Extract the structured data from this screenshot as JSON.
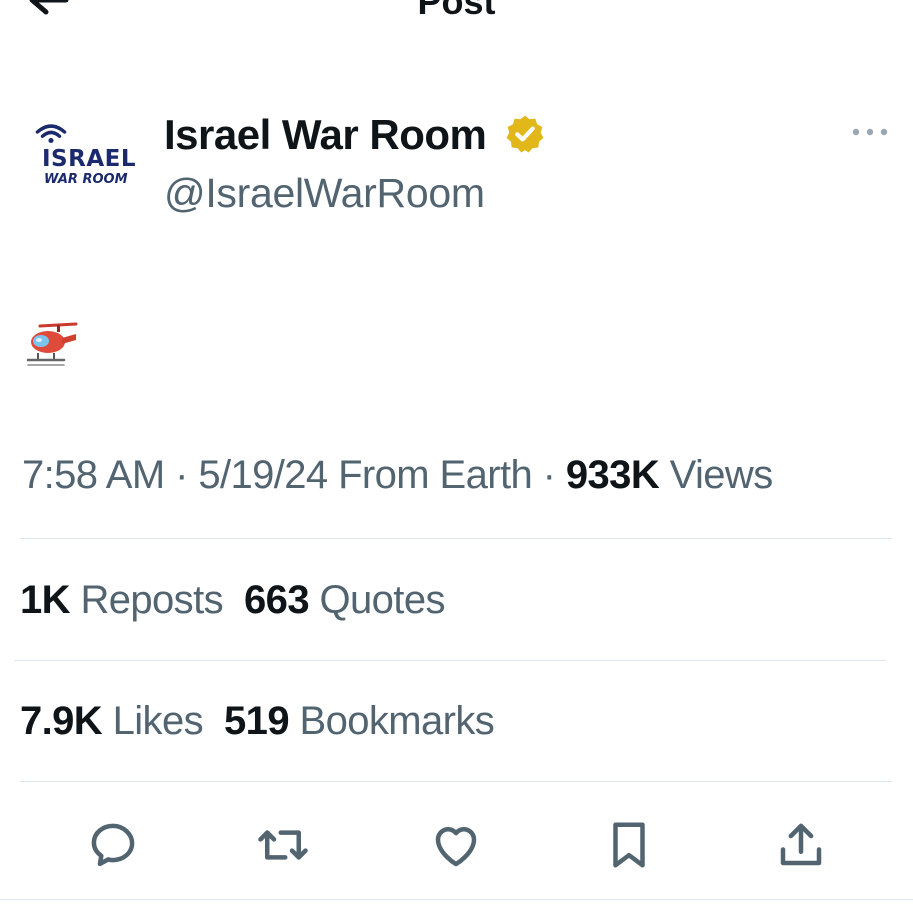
{
  "header": {
    "title": "Post",
    "back_icon": "arrow-left-icon"
  },
  "author": {
    "avatar_logo_line1": "ISRAEL",
    "avatar_logo_line2": "WAR ROOM",
    "display_name": "Israel War Room",
    "handle": "@IsraelWarRoom",
    "verified_icon": "verified-gold-badge-icon",
    "more_icon": "more-horizontal-icon"
  },
  "post": {
    "body_emoji": "helicopter-emoji",
    "time": "7:58 AM",
    "date": "5/19/24",
    "location": "From Earth",
    "views_count": "933K",
    "views_label": "Views"
  },
  "stats": {
    "reposts_count": "1K",
    "reposts_label": "Reposts",
    "quotes_count": "663",
    "quotes_label": "Quotes",
    "likes_count": "7.9K",
    "likes_label": "Likes",
    "bookmarks_count": "519",
    "bookmarks_label": "Bookmarks"
  },
  "actions": [
    "reply-icon",
    "repost-icon",
    "like-icon",
    "bookmark-icon",
    "share-icon"
  ],
  "colors": {
    "text": "#0f1419",
    "secondary": "#536471",
    "divider": "#e1e6ea",
    "verified_gold": "#e2b719",
    "logo_navy": "#1a2a6c"
  }
}
